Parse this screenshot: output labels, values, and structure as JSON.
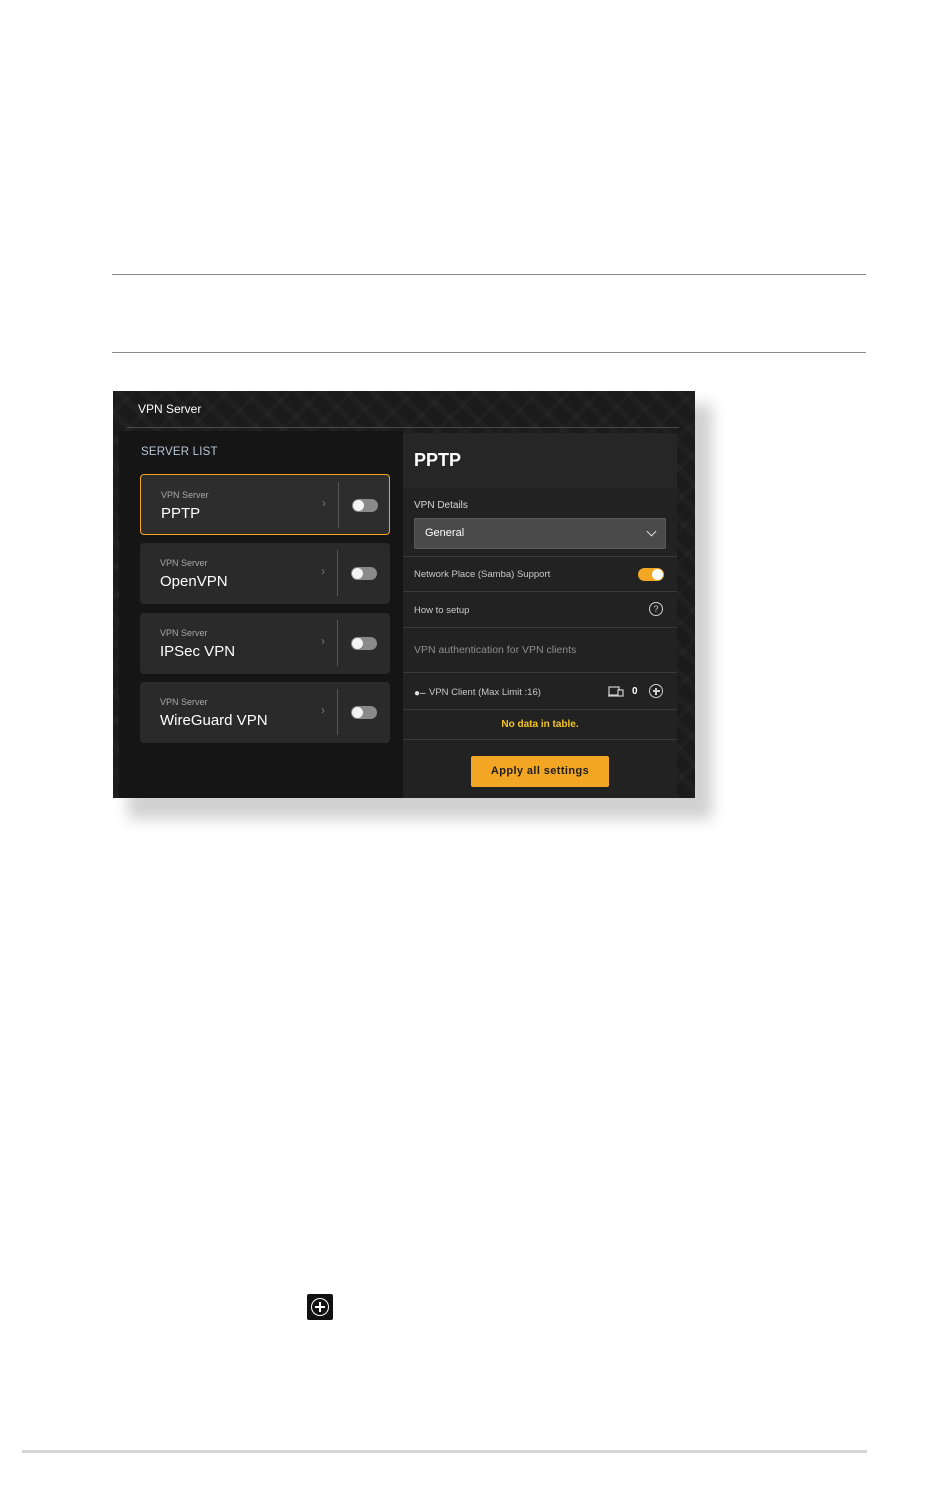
{
  "window": {
    "title": "VPN Server"
  },
  "server_list": {
    "label": "SERVER LIST",
    "items": [
      {
        "sub": "VPN Server",
        "name": "PPTP",
        "active": true,
        "enabled": false
      },
      {
        "sub": "VPN Server",
        "name": "OpenVPN",
        "active": false,
        "enabled": false
      },
      {
        "sub": "VPN Server",
        "name": "IPSec VPN",
        "active": false,
        "enabled": false
      },
      {
        "sub": "VPN Server",
        "name": "WireGuard VPN",
        "active": false,
        "enabled": false
      }
    ]
  },
  "detail": {
    "title": "PPTP",
    "details_label": "VPN Details",
    "dropdown_value": "General",
    "samba_label": "Network Place (Samba) Support",
    "samba_enabled": true,
    "how_to_label": "How to setup",
    "auth_label": "VPN authentication for VPN clients",
    "client_label": "VPN Client (Max Limit :16)",
    "client_count": "0",
    "no_data": "No data in table.",
    "apply_label": "Apply all settings"
  },
  "colors": {
    "accent": "#f3a623",
    "panel": "#222222",
    "background": "#1b1b1b"
  },
  "icons": [
    "chevron-right-icon",
    "chevron-down-icon",
    "help-icon",
    "key-icon",
    "device-icon",
    "add-circle-icon"
  ]
}
